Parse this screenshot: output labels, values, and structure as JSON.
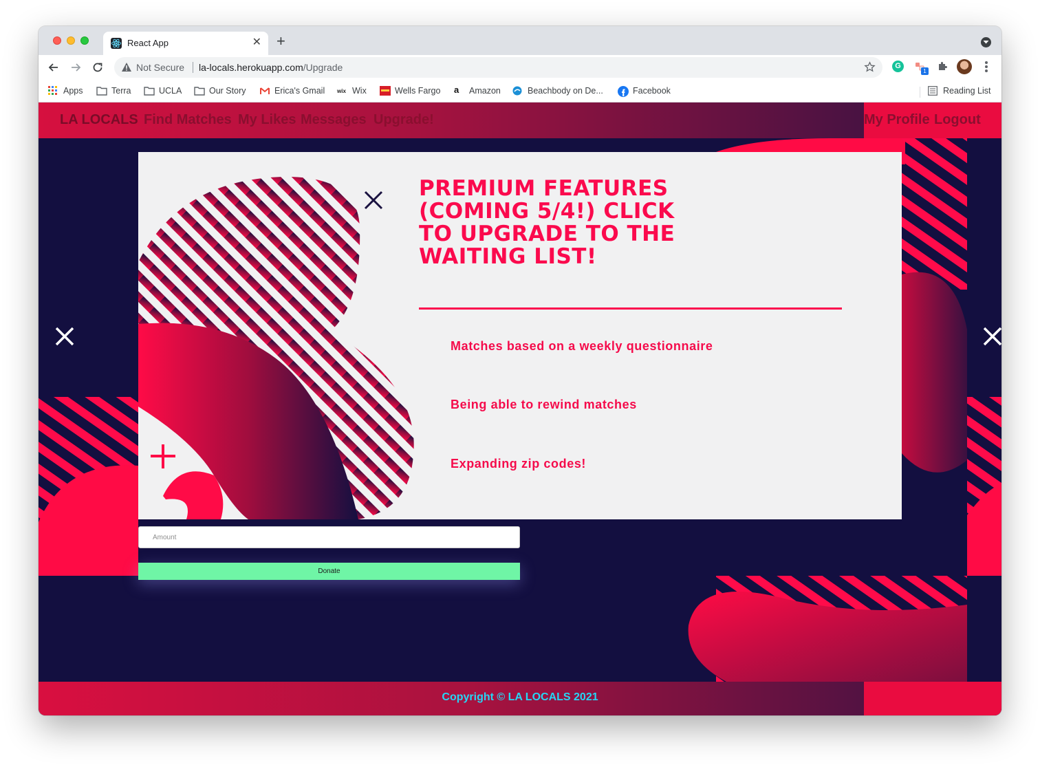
{
  "browser": {
    "tab_title": "React App",
    "security_label": "Not Secure",
    "url_host": "la-locals.herokuapp.com",
    "url_path": "/Upgrade",
    "extension_badge": "1",
    "grammarly_letter": "G"
  },
  "bookmarks": [
    {
      "label": "Apps",
      "icon": "apps-grid-icon"
    },
    {
      "label": "Terra",
      "icon": "folder-icon"
    },
    {
      "label": "UCLA",
      "icon": "folder-icon"
    },
    {
      "label": "Our Story",
      "icon": "folder-icon"
    },
    {
      "label": "Erica's Gmail",
      "icon": "gmail-icon"
    },
    {
      "label": "Wix",
      "icon": "wix-icon"
    },
    {
      "label": "Wells Fargo",
      "icon": "wells-fargo-icon"
    },
    {
      "label": "Amazon",
      "icon": "amazon-icon"
    },
    {
      "label": "Beachbody on De...",
      "icon": "beachbody-icon"
    },
    {
      "label": "Facebook",
      "icon": "facebook-icon"
    }
  ],
  "reading_list": "Reading List",
  "nav": {
    "brand": "LA LOCALS",
    "links": [
      "Find Matches",
      "My Likes",
      "Messages",
      "Upgrade!"
    ],
    "right_links": [
      "My Profile",
      "Logout"
    ]
  },
  "upgrade": {
    "heading": "PREMIUM FEATURES (COMING 5/4!) CLICK TO UPGRADE TO THE WAITING LIST!",
    "features": [
      "Matches based on a weekly questionnaire",
      "Being able to rewind matches",
      "Expanding zip codes!"
    ],
    "amount_placeholder": "Amount",
    "donate_label": "Donate"
  },
  "footer": {
    "copyright": "Copyright © LA LOCALS 2021"
  },
  "colors": {
    "page_bg": "#130f40",
    "accent": "#fb0a4d",
    "donate": "#6ff5a6",
    "footer_text": "#25d7f5"
  }
}
